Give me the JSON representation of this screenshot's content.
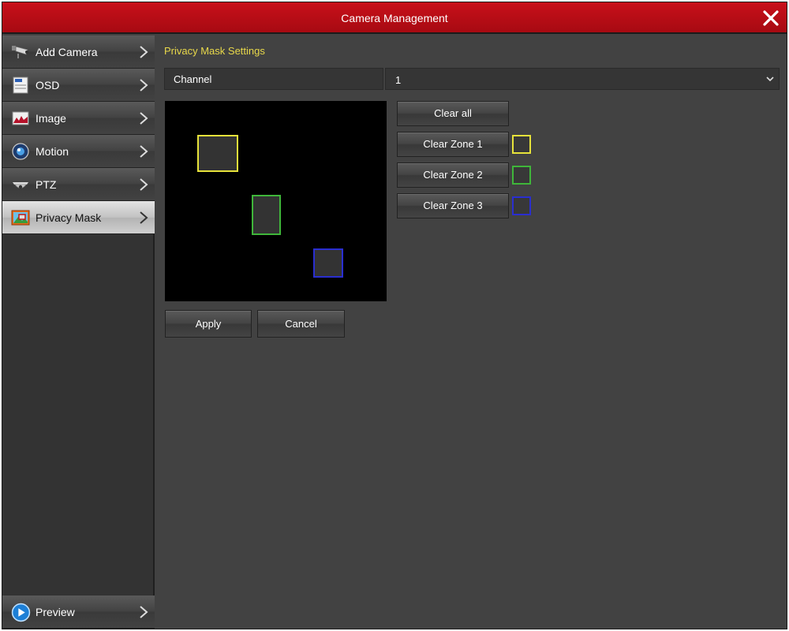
{
  "window": {
    "title": "Camera Management",
    "close_icon": "close-icon"
  },
  "sidebar": {
    "items": [
      {
        "label": "Add Camera",
        "icon": "camera-icon",
        "active": false
      },
      {
        "label": "OSD",
        "icon": "osd-icon",
        "active": false
      },
      {
        "label": "Image",
        "icon": "image-icon",
        "active": false
      },
      {
        "label": "Motion",
        "icon": "motion-icon",
        "active": false
      },
      {
        "label": "PTZ",
        "icon": "ptz-icon",
        "active": false
      },
      {
        "label": "Privacy Mask",
        "icon": "privacy-mask-icon",
        "active": true
      }
    ],
    "footer": {
      "label": "Preview",
      "icon": "play-icon"
    }
  },
  "main": {
    "section_title": "Privacy Mask Settings",
    "channel": {
      "label": "Channel",
      "value": "1"
    },
    "buttons": {
      "clear_all": "Clear all",
      "clear_zone_1": "Clear Zone 1",
      "clear_zone_2": "Clear Zone 2",
      "clear_zone_3": "Clear Zone 3",
      "apply": "Apply",
      "cancel": "Cancel"
    },
    "zones": [
      {
        "name": "Zone 1",
        "color": "#e6e23a"
      },
      {
        "name": "Zone 2",
        "color": "#3fb63a"
      },
      {
        "name": "Zone 3",
        "color": "#2a2ed0"
      }
    ]
  },
  "colors": {
    "accent": "#c8101a",
    "section_title": "#e8d84a",
    "background": "#424242"
  }
}
